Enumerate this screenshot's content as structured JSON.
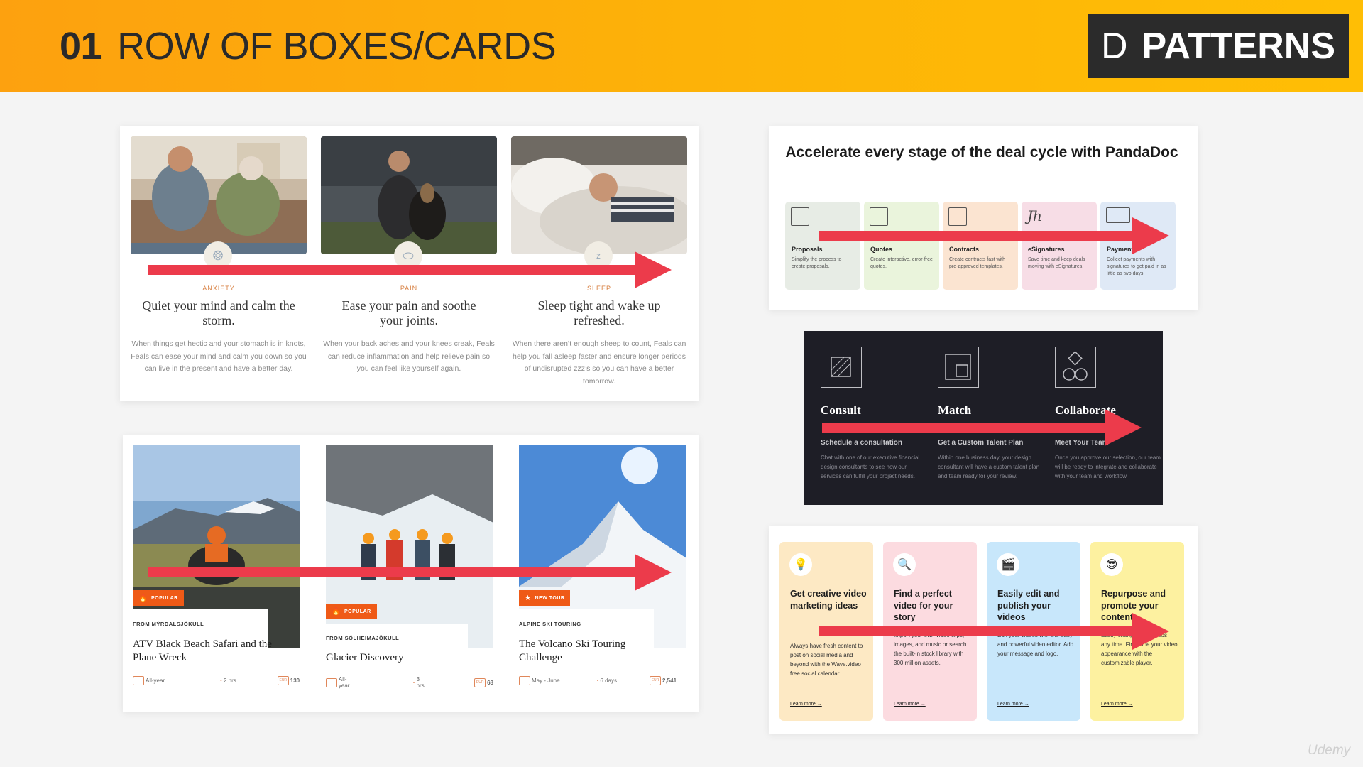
{
  "header": {
    "number": "01",
    "title": "ROW OF BOXES/CARDS",
    "badge_letter": "D",
    "badge_text": "PATTERNS"
  },
  "feals": {
    "cards": [
      {
        "category": "ANXIETY",
        "headline": "Quiet your mind and calm the storm.",
        "body": "When things get hectic and your stomach is in knots, Feals can ease your mind and calm you down so you can live in the present and have a better day."
      },
      {
        "category": "PAIN",
        "headline": "Ease your pain and soothe your joints.",
        "body": "When your back aches and your knees creak, Feals can reduce inflammation and help relieve pain so you can feel like yourself again."
      },
      {
        "category": "SLEEP",
        "headline": "Sleep tight and wake up refreshed.",
        "body": "When there aren’t enough sheep to count, Feals can help you fall asleep faster and ensure longer periods of undisrupted zzz’s so you can have a better tomorrow."
      }
    ]
  },
  "pandadoc": {
    "title": "Accelerate every stage of the deal cycle with PandaDoc",
    "cards": [
      {
        "name": "Proposals",
        "desc": "Simplify the process to create proposals.",
        "color": "#e7ece5"
      },
      {
        "name": "Quotes",
        "desc": "Create interactive, error-free quotes.",
        "color": "#eaf4dc"
      },
      {
        "name": "Contracts",
        "desc": "Create contracts fast with pre-approved templates.",
        "color": "#fbe4d1"
      },
      {
        "name": "eSignatures",
        "desc": "Save time and keep deals moving with eSignatures.",
        "color": "#f7dde6"
      },
      {
        "name": "Payments",
        "desc": "Collect payments with signatures to get paid in as little as two days.",
        "color": "#dfe9f6"
      }
    ]
  },
  "toptal": {
    "steps": [
      {
        "name": "Consult",
        "sub": "Schedule a consultation",
        "desc": "Chat with one of our executive financial design consultants to see how our services can fulfill your project needs."
      },
      {
        "name": "Match",
        "sub": "Get a Custom Talent Plan",
        "desc": "Within one business day, your design consultant will have a custom talent plan and team ready for your review."
      },
      {
        "name": "Collaborate",
        "sub": "Meet Your Team",
        "desc": "Once you approve our selection, our team will be ready to integrate and collaborate with your team and workflow."
      }
    ]
  },
  "tours": {
    "cards": [
      {
        "badge": "POPULAR",
        "from": "FROM MÝRDALSJÖKULL",
        "name": "ATV Black Beach Safari and the Plane Wreck",
        "season": "All-year",
        "duration": "2 hrs",
        "currency": "EUR",
        "price": "130"
      },
      {
        "badge": "POPULAR",
        "from": "FROM SÓLHEIMAJÖKULL",
        "name": "Glacier Discovery",
        "season": "All-year",
        "duration": "3 hrs",
        "currency": "EUR",
        "price": "68"
      },
      {
        "badge": "NEW TOUR",
        "from": "ALPINE SKI TOURING",
        "name": "The Volcano Ski Touring Challenge",
        "season": "May - June",
        "duration": "6 days",
        "currency": "EUR",
        "price": "2,541"
      }
    ]
  },
  "wave": {
    "learn_more": "Learn more →",
    "cards": [
      {
        "icon": "lightbulb-icon",
        "glyph": "💡",
        "headline": "Get creative video marketing ideas",
        "body": "Always have fresh content to post on social media and beyond with the Wave.video free social calendar.",
        "color": "#fde9c4"
      },
      {
        "icon": "magnifier-icon",
        "glyph": "🔍",
        "headline": "Find a perfect video for your story",
        "body": "Import your own video clips, images, and music or search the built-in stock library with 300 million assets.",
        "color": "#fcdbe0"
      },
      {
        "icon": "clapper-icon",
        "glyph": "🎬",
        "headline": "Easily edit and publish your videos",
        "body": "Edit your videos with the easy and powerful video editor. Add your message and logo.",
        "color": "#c8e7fb"
      },
      {
        "icon": "sunglasses-icon",
        "glyph": "😎",
        "headline": "Repurpose and promote your content",
        "body": "Easily change your videos any time. Fine-tune your video appearance with the customizable player.",
        "color": "#fdf1a0"
      }
    ]
  },
  "watermark": "Udemy",
  "colors": {
    "arrow": "#ec3b4b",
    "header": "#fdb507",
    "badge_bg": "#2b2b2b"
  }
}
